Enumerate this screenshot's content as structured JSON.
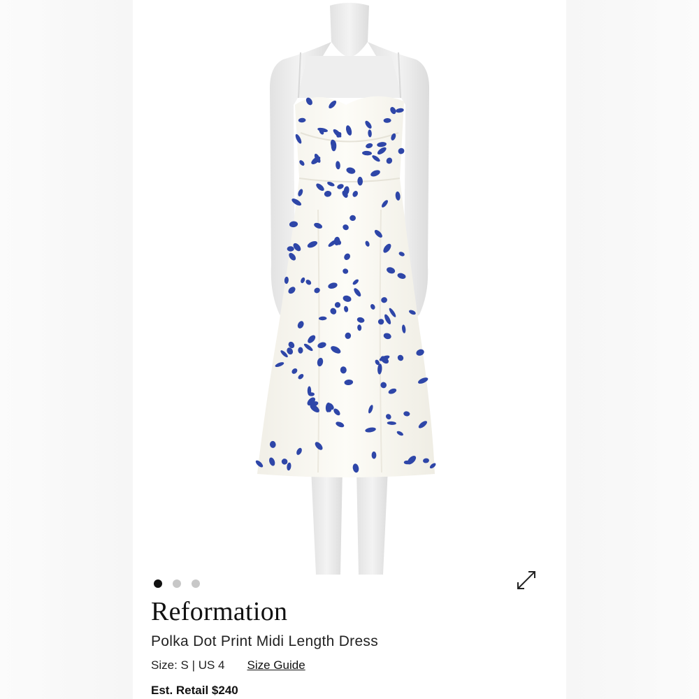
{
  "carousel": {
    "pages": 3,
    "active_index": 0
  },
  "icons": {
    "expand": "expand-arrows-icon"
  },
  "product": {
    "brand": "Reformation",
    "title": "Polka Dot Print Midi Length Dress",
    "size_text": "Size: S | US 4",
    "size_guide_label": "Size Guide",
    "retail_text": "Est. Retail $240"
  },
  "colors": {
    "print_blue": "#2e46a8",
    "dress_white": "#fbfaf4",
    "mannequin": "#ededed"
  }
}
